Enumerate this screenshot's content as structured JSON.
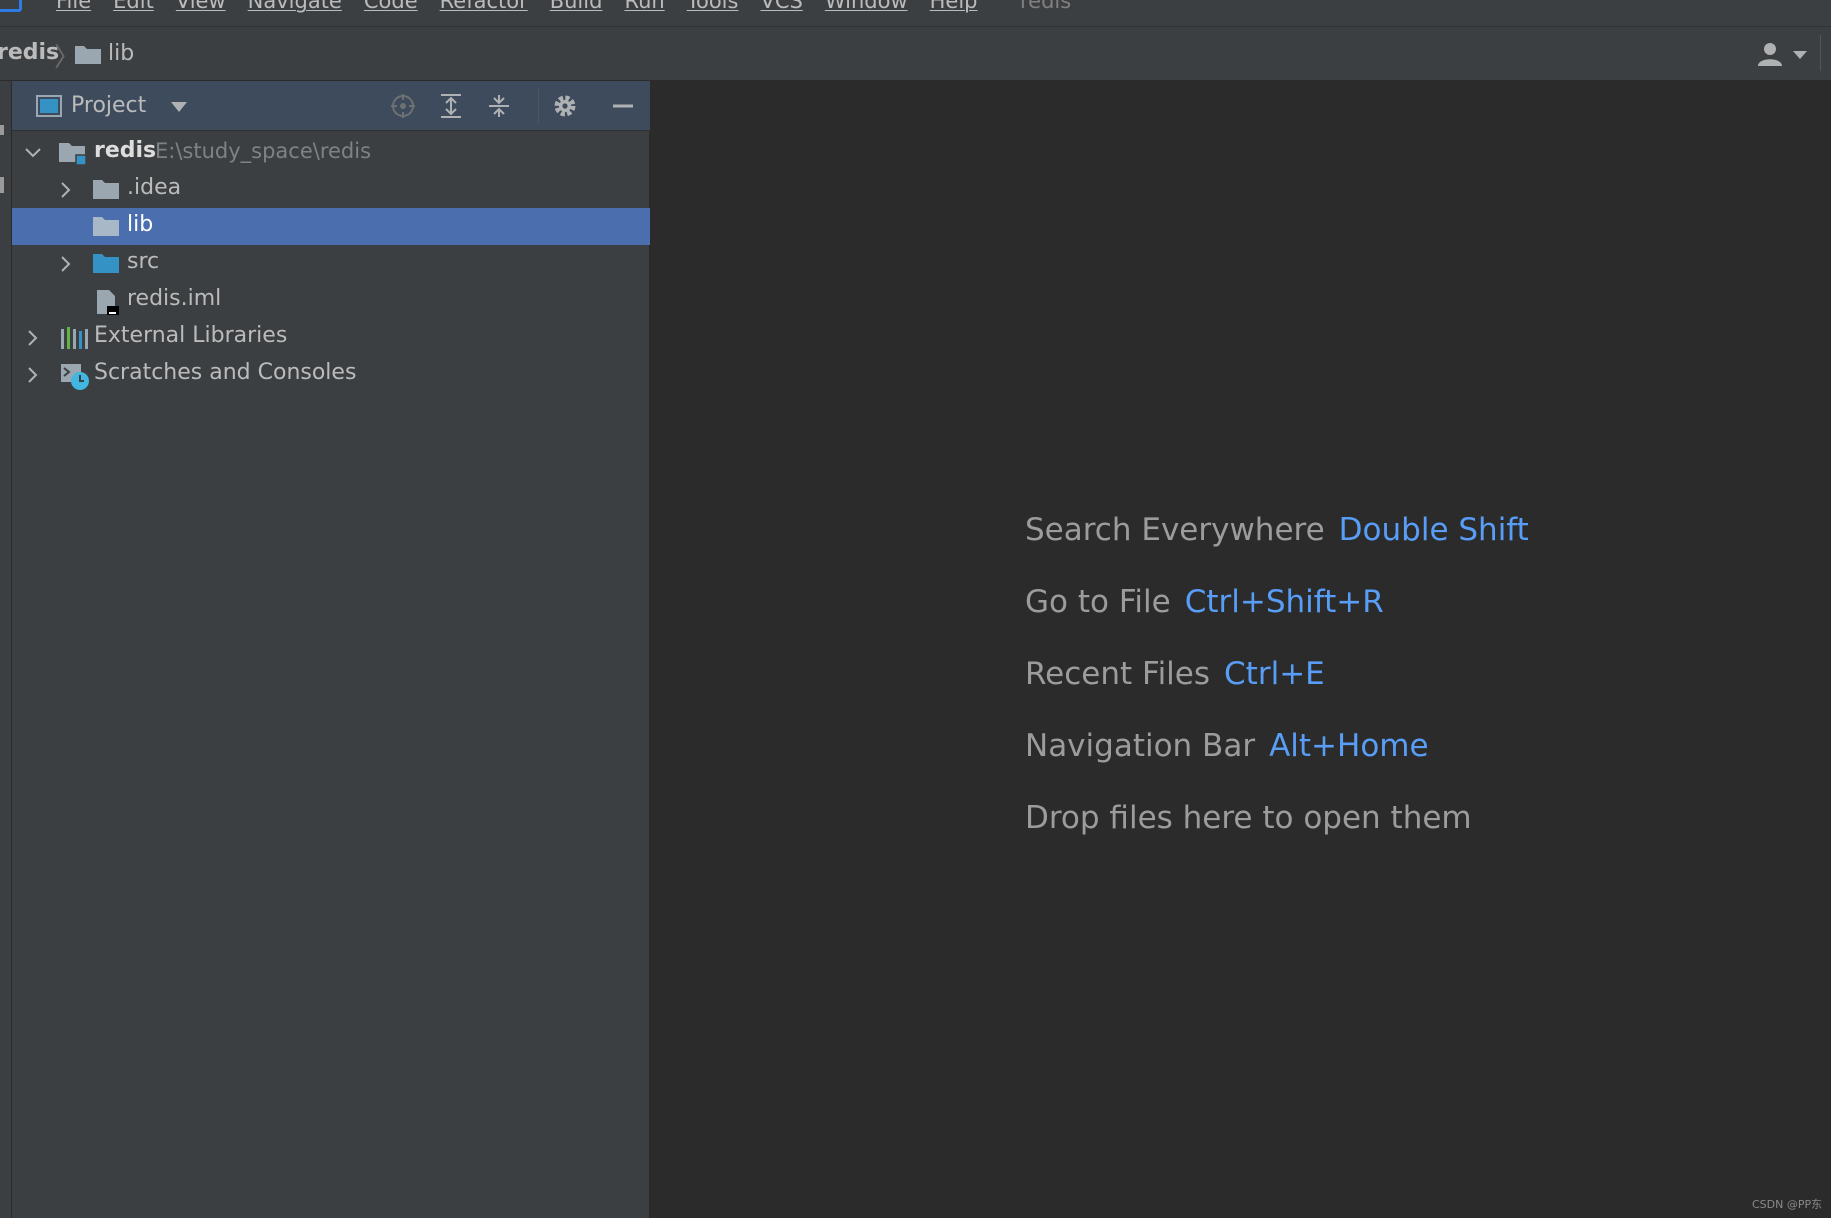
{
  "menubar": {
    "items": [
      "File",
      "Edit",
      "View",
      "Navigate",
      "Code",
      "Refactor",
      "Build",
      "Run",
      "Tools",
      "VCS",
      "Window",
      "Help"
    ],
    "window_title": "redis"
  },
  "navbar": {
    "breadcrumb_root": "redis",
    "breadcrumb_sep": "〉",
    "breadcrumb_current": "lib"
  },
  "project_panel": {
    "title": "Project",
    "tree": [
      {
        "label": "redis",
        "path": "E:\\study_space\\redis",
        "icon": "module-folder-icon"
      },
      {
        "label": ".idea",
        "icon": "folder-icon"
      },
      {
        "label": "lib",
        "icon": "folder-icon",
        "selected": true
      },
      {
        "label": "src",
        "icon": "source-folder-icon"
      },
      {
        "label": "redis.iml",
        "icon": "iml-file-icon"
      },
      {
        "label": "External Libraries",
        "icon": "libraries-icon"
      },
      {
        "label": "Scratches and Consoles",
        "icon": "scratches-icon"
      }
    ]
  },
  "editor": {
    "hints": [
      {
        "label": "Search Everywhere",
        "shortcut": "Double Shift"
      },
      {
        "label": "Go to File",
        "shortcut": "Ctrl+Shift+R"
      },
      {
        "label": "Recent Files",
        "shortcut": "Ctrl+E"
      },
      {
        "label": "Navigation Bar",
        "shortcut": "Alt+Home"
      }
    ],
    "drop_hint": "Drop files here to open them"
  },
  "watermark": "CSDN @PP东",
  "colors": {
    "accent_blue": "#589df6",
    "selection": "#4b6eaf",
    "panel_bg": "#3c3f41",
    "editor_bg": "#2b2b2b"
  }
}
